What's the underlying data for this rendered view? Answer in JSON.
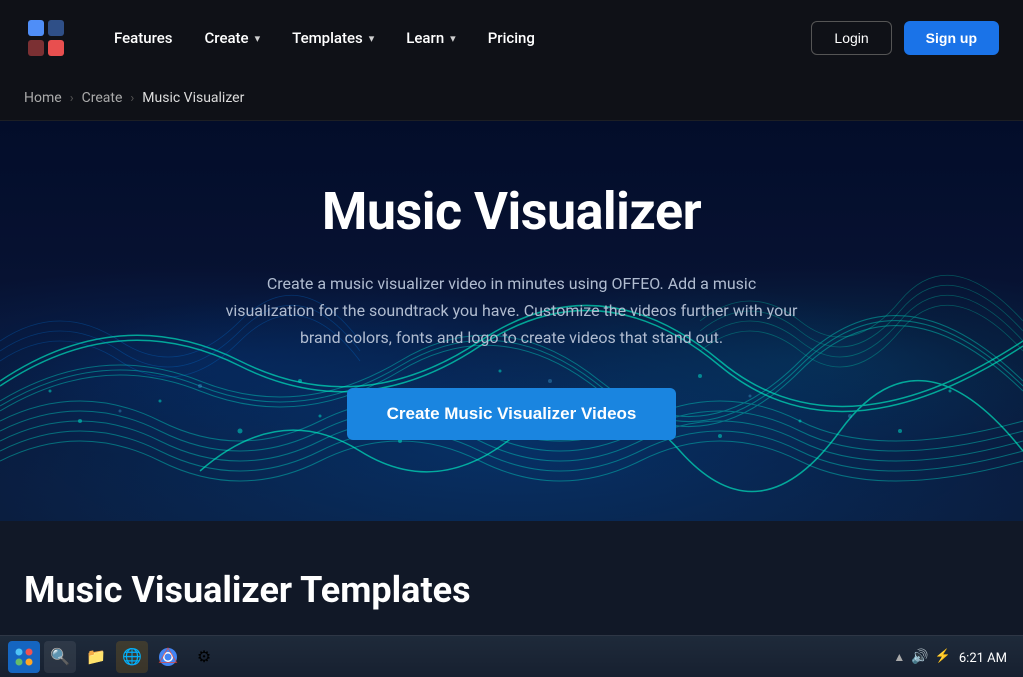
{
  "brand": {
    "name": "OFFEO",
    "logo_colors": [
      "#4f8ef7",
      "#e84f4f"
    ]
  },
  "navbar": {
    "features_label": "Features",
    "create_label": "Create",
    "templates_label": "Templates",
    "learn_label": "Learn",
    "pricing_label": "Pricing",
    "login_label": "Login",
    "signup_label": "Sign up"
  },
  "breadcrumb": {
    "home_label": "Home",
    "create_label": "Create",
    "current_label": "Music Visualizer"
  },
  "hero": {
    "title": "Music Visualizer",
    "description": "Create a music visualizer video in minutes using OFFEO. Add a music visualization for the soundtrack you have. Customize the videos further with your brand colors, fonts and logo to create videos that stand out.",
    "cta_label": "Create Music Visualizer Videos"
  },
  "section": {
    "title": "Music Visualizer Templates"
  },
  "taskbar": {
    "time": "6:21 AM",
    "icons": [
      "⊞",
      "🔍",
      "📁",
      "🌐",
      "⚙"
    ]
  },
  "colors": {
    "navbar_bg": "#0f1117",
    "hero_bg": "#071232",
    "cta_color": "#1a85e0",
    "section_bg": "#111827"
  }
}
